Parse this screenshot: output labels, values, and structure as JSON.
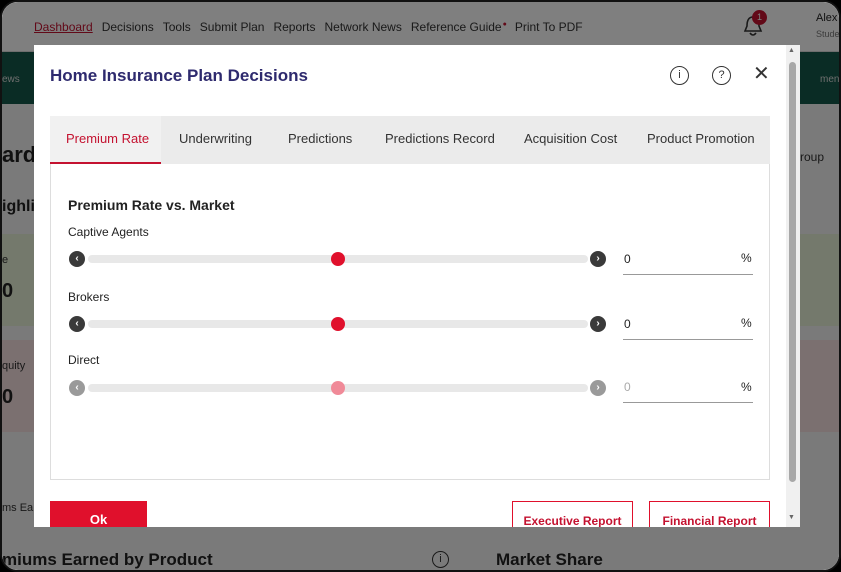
{
  "app": {
    "nav": [
      {
        "label": "Dashboard"
      },
      {
        "label": "Decisions"
      },
      {
        "label": "Tools"
      },
      {
        "label": "Submit Plan"
      },
      {
        "label": "Reports"
      },
      {
        "label": "Network News"
      },
      {
        "label": "Reference Guide"
      },
      {
        "label": "Print To PDF"
      }
    ],
    "notification_count": "1",
    "user_name": "Alex",
    "user_role": "Stude",
    "subbar_left": "ews",
    "subbar_right": "ment intr",
    "bg_title": "ard",
    "bg_group": "roup",
    "bg_highlight": "ighli",
    "card1_a": "e",
    "card1_b": "0",
    "card2_a": "quity",
    "card2_b": "0",
    "earned_label": "ms Ea",
    "bottom_left": "miums Earned by Product",
    "bottom_right": "Market Share"
  },
  "modal": {
    "title": "Home Insurance Plan Decisions",
    "tabs": [
      {
        "label": "Premium Rate"
      },
      {
        "label": "Underwriting"
      },
      {
        "label": "Predictions"
      },
      {
        "label": "Predictions Record"
      },
      {
        "label": "Acquisition Cost"
      },
      {
        "label": "Product Promotion"
      }
    ],
    "section_title": "Premium Rate vs. Market",
    "sliders": [
      {
        "label": "Captive Agents",
        "value": "0",
        "unit": "%",
        "position": 0.5,
        "enabled": true
      },
      {
        "label": "Brokers",
        "value": "0",
        "unit": "%",
        "position": 0.5,
        "enabled": true
      },
      {
        "label": "Direct",
        "value": "0",
        "unit": "%",
        "position": 0.5,
        "enabled": false
      }
    ],
    "ok_label": "Ok",
    "executive_report_label": "Executive Report",
    "financial_report_label": "Financial Report"
  }
}
